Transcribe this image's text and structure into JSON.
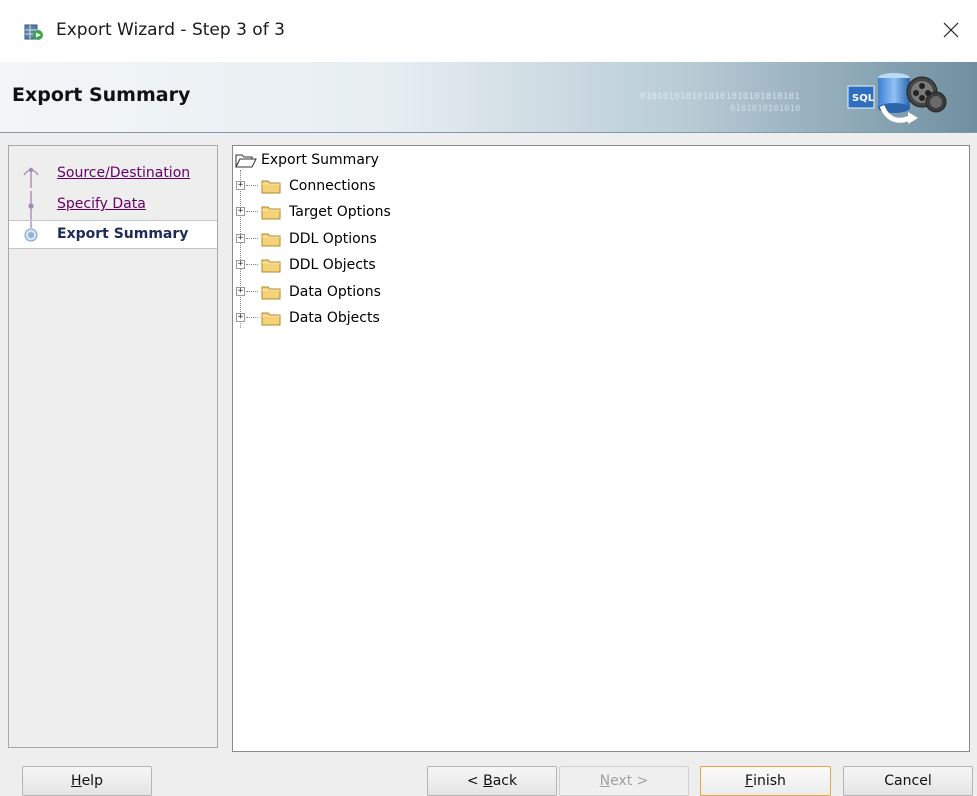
{
  "window": {
    "title": "Export Wizard - Step 3 of 3",
    "close_glyph": "✕",
    "app_icon": "export-wizard-icon"
  },
  "header": {
    "title": "Export Summary",
    "binary_text": "0101010101010101010101010101",
    "binary_text2": "0101010101010"
  },
  "nav": {
    "items": [
      {
        "label": "Source/Destination",
        "state": "visited"
      },
      {
        "label": "Specify Data",
        "state": "visited"
      },
      {
        "label": "Export Summary",
        "state": "current"
      }
    ]
  },
  "tree": {
    "root": "Export Summary",
    "nodes": [
      {
        "label": "Connections",
        "expander": "+"
      },
      {
        "label": "Target Options",
        "expander": "+"
      },
      {
        "label": "DDL Options",
        "expander": "+"
      },
      {
        "label": "DDL Objects",
        "expander": "+"
      },
      {
        "label": "Data Options",
        "expander": "+"
      },
      {
        "label": "Data Objects",
        "expander": "+"
      }
    ]
  },
  "buttons": {
    "help": {
      "mnemonic": "H",
      "rest": "elp"
    },
    "back": {
      "prefix": "< ",
      "mnemonic": "B",
      "rest": "ack"
    },
    "next": {
      "mnemonic": "N",
      "rest": "ext >"
    },
    "finish": {
      "mnemonic": "F",
      "rest": "inish"
    },
    "cancel": {
      "label": "Cancel"
    }
  },
  "colors": {
    "link": "#660066",
    "current_step": "#1e2a5a",
    "default_button_border": "#e8a640",
    "folder_fill": "#f4d27a"
  }
}
